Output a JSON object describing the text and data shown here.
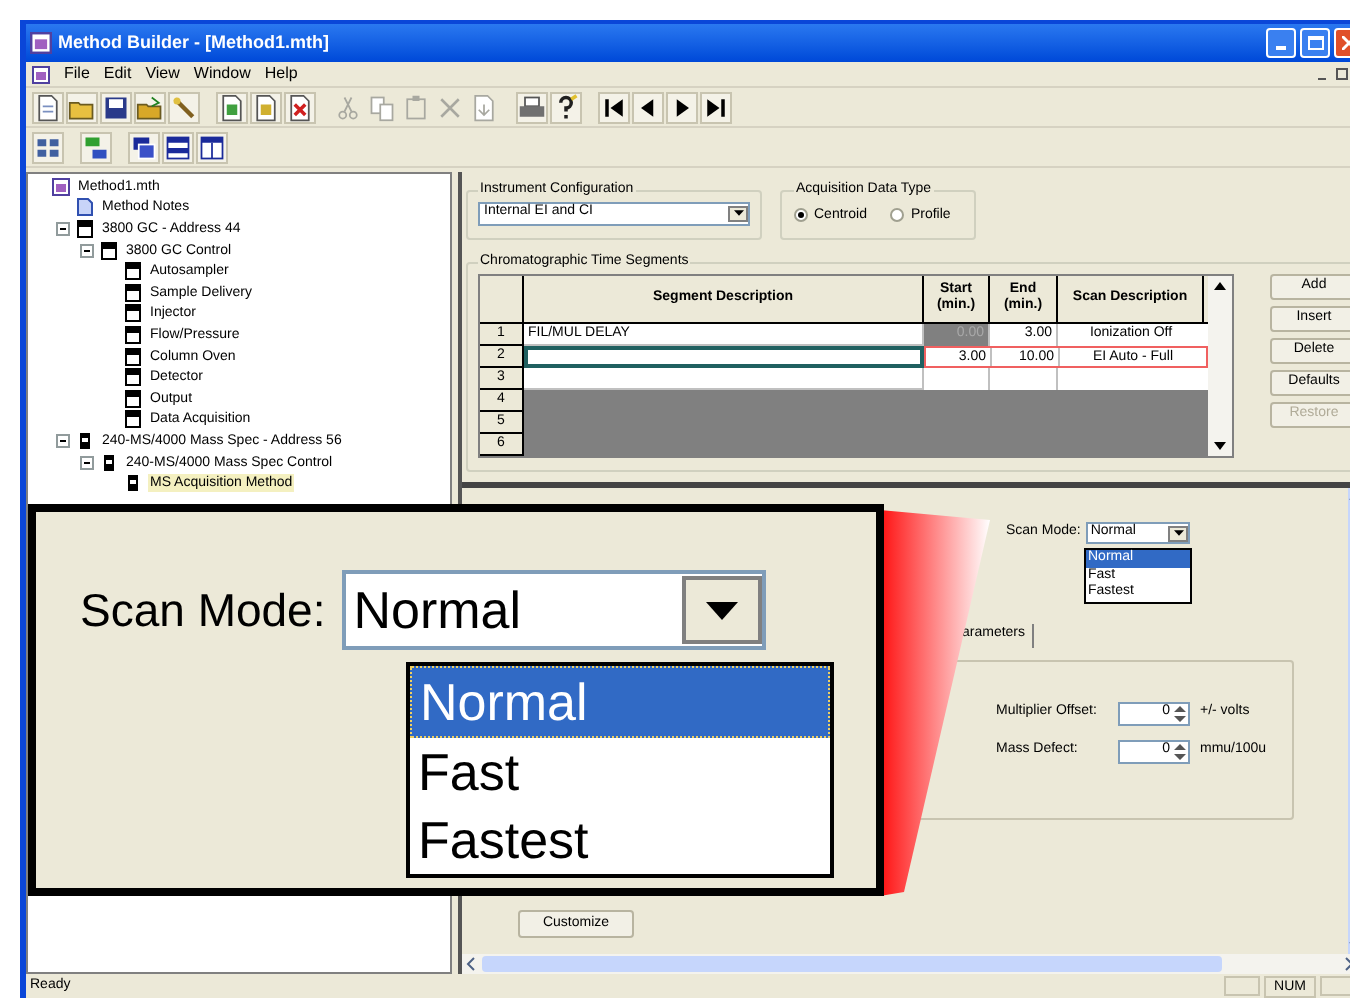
{
  "window": {
    "title": "Method Builder - [Method1.mth]"
  },
  "menu": [
    "File",
    "Edit",
    "View",
    "Window",
    "Help"
  ],
  "toolbars": [
    [
      [
        {
          "kind": "new",
          "disabled": false
        },
        {
          "kind": "open",
          "disabled": false
        },
        {
          "kind": "save",
          "disabled": false
        },
        {
          "kind": "folder",
          "disabled": false
        },
        {
          "kind": "wand",
          "disabled": false
        }
      ],
      [
        {
          "kind": "doc-a",
          "disabled": false
        },
        {
          "kind": "doc-b",
          "disabled": false
        },
        {
          "kind": "doc-x",
          "disabled": false
        }
      ],
      [
        {
          "kind": "cut",
          "disabled": true
        },
        {
          "kind": "copy",
          "disabled": true
        },
        {
          "kind": "paste",
          "disabled": true
        },
        {
          "kind": "delete",
          "disabled": true
        },
        {
          "kind": "insert",
          "disabled": true
        }
      ],
      [
        {
          "kind": "print",
          "disabled": false
        },
        {
          "kind": "help",
          "disabled": false
        }
      ],
      [
        {
          "kind": "first",
          "disabled": false
        },
        {
          "kind": "prev",
          "disabled": false
        },
        {
          "kind": "next",
          "disabled": false
        },
        {
          "kind": "last",
          "disabled": false
        }
      ]
    ],
    [
      [
        {
          "kind": "view-list",
          "disabled": false
        }
      ],
      [
        {
          "kind": "tree-view",
          "disabled": false
        }
      ],
      [
        {
          "kind": "cascade",
          "disabled": false
        },
        {
          "kind": "tile-h",
          "disabled": false
        },
        {
          "kind": "tile-v",
          "disabled": false
        }
      ]
    ]
  ],
  "tree": [
    {
      "label": "Method1.mth",
      "kind": "method",
      "selected": false,
      "children": [
        {
          "label": "Method Notes",
          "kind": "notes",
          "selected": false
        },
        {
          "label": "3800 GC - Address 44",
          "kind": "module",
          "selected": false,
          "expanded": true,
          "children": [
            {
              "label": "3800 GC Control",
              "kind": "module",
              "selected": false,
              "expanded": true,
              "children": [
                {
                  "label": "Autosampler",
                  "kind": "module",
                  "selected": false
                },
                {
                  "label": "Sample Delivery",
                  "kind": "module",
                  "selected": false
                },
                {
                  "label": "Injector",
                  "kind": "module",
                  "selected": false
                },
                {
                  "label": "Flow/Pressure",
                  "kind": "module",
                  "selected": false
                },
                {
                  "label": "Column Oven",
                  "kind": "module",
                  "selected": false
                },
                {
                  "label": "Detector",
                  "kind": "module",
                  "selected": false
                },
                {
                  "label": "Output",
                  "kind": "module",
                  "selected": false
                },
                {
                  "label": "Data Acquisition",
                  "kind": "module",
                  "selected": false
                }
              ]
            }
          ]
        },
        {
          "label": "240-MS/4000 Mass Spec - Address 56",
          "kind": "ms",
          "selected": false,
          "expanded": true,
          "children": [
            {
              "label": "240-MS/4000 Mass Spec Control",
              "kind": "ms",
              "selected": false,
              "expanded": true,
              "children": [
                {
                  "label": "MS Acquisition Method",
                  "kind": "ms",
                  "selected": true
                }
              ]
            }
          ]
        }
      ]
    }
  ],
  "instrument_configuration": {
    "label": "Instrument Configuration",
    "value": "Internal EI and CI"
  },
  "acquisition_data_type": {
    "label": "Acquisition Data Type",
    "options": [
      {
        "label": "Centroid",
        "selected": true
      },
      {
        "label": "Profile",
        "selected": false
      }
    ]
  },
  "time_segments": {
    "label": "Chromatographic Time Segments",
    "columns": [
      "Segment Description",
      "Start (min.)",
      "End (min.)",
      "Scan Description"
    ],
    "rows": [
      {
        "number": "1",
        "kind": "entry",
        "selected": false,
        "start_locked": true,
        "description": "FIL/MUL DELAY",
        "start": "0.00",
        "end": "3.00",
        "scan": "Ionization Off"
      },
      {
        "number": "2",
        "kind": "entry",
        "selected": true,
        "start_locked": false,
        "start": "3.00",
        "end": "10.00",
        "scan": "EI Auto - Full"
      },
      {
        "number": "3",
        "kind": "entry",
        "selected": false,
        "start_locked": false
      },
      {
        "number": "4",
        "kind": "blank"
      },
      {
        "number": "5",
        "kind": "blank"
      },
      {
        "number": "6",
        "kind": "blank"
      }
    ]
  },
  "segment_buttons": [
    {
      "label": "Add",
      "disabled": false
    },
    {
      "label": "Insert",
      "disabled": false
    },
    {
      "label": "Delete",
      "disabled": false
    },
    {
      "label": "Defaults",
      "disabled": false
    },
    {
      "label": "Restore",
      "disabled": true
    }
  ],
  "scan_mode": {
    "label": "Scan Mode:",
    "value": "Normal",
    "options": [
      {
        "label": "Normal",
        "selected": true
      },
      {
        "label": "Fast",
        "selected": false
      },
      {
        "label": "Fastest",
        "selected": false
      }
    ]
  },
  "tab": {
    "label": "arameters"
  },
  "parameters": [
    {
      "label": "Multiplier Offset:",
      "value": "0",
      "unit": "+/- volts"
    },
    {
      "label": "Mass Defect:",
      "value": "0",
      "unit": "mmu/100u"
    }
  ],
  "customize_button": "Customize",
  "status_bar": {
    "text": "Ready",
    "indicators": [
      "NUM"
    ]
  },
  "callout": {
    "label": "Scan Mode:",
    "value": "Normal",
    "options": [
      {
        "label": "Normal",
        "selected": true
      },
      {
        "label": "Fast",
        "selected": false
      },
      {
        "label": "Fastest",
        "selected": false
      }
    ]
  }
}
